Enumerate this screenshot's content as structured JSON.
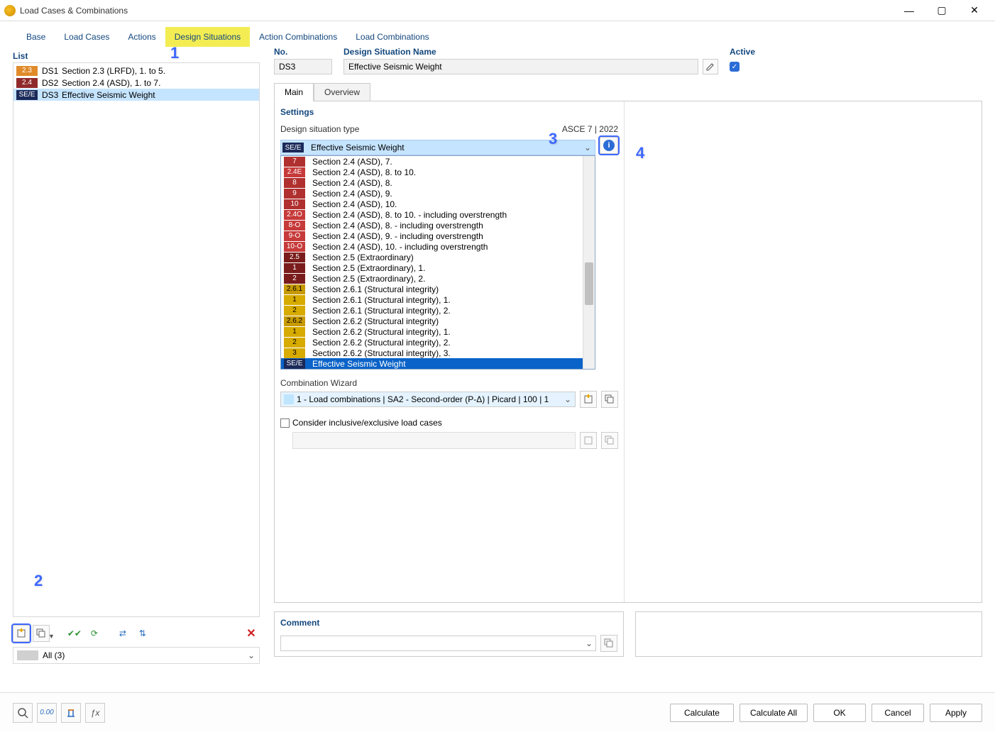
{
  "window": {
    "title": "Load Cases & Combinations"
  },
  "tabs": [
    {
      "label": "Base"
    },
    {
      "label": "Load Cases"
    },
    {
      "label": "Actions"
    },
    {
      "label": "Design Situations",
      "active": true
    },
    {
      "label": "Action Combinations"
    },
    {
      "label": "Load Combinations"
    }
  ],
  "left": {
    "title": "List",
    "items": [
      {
        "tag": "2.3",
        "tagClass": "c-orange",
        "id": "DS1",
        "name": "Section 2.3 (LRFD), 1. to 5."
      },
      {
        "tag": "2.4",
        "tagClass": "c-maroon",
        "id": "DS2",
        "name": "Section 2.4 (ASD), 1. to 7."
      },
      {
        "tag": "SE/E",
        "tagClass": "c-navy",
        "id": "DS3",
        "name": "Effective Seismic Weight",
        "selected": true
      }
    ],
    "filter": "All (3)"
  },
  "header": {
    "no_label": "No.",
    "no_value": "DS3",
    "name_label": "Design Situation Name",
    "name_value": "Effective Seismic Weight",
    "active_label": "Active"
  },
  "subtabs": {
    "main": "Main",
    "overview": "Overview"
  },
  "settings": {
    "title": "Settings",
    "type_label": "Design situation type",
    "code": "ASCE 7 | 2022",
    "combo_tag": "SE/E",
    "combo_text": "Effective Seismic Weight",
    "options": [
      {
        "tag": "7",
        "tc": "c-red1",
        "text": "Section 2.4 (ASD), 7."
      },
      {
        "tag": "2.4E",
        "tc": "c-red2",
        "text": "Section 2.4 (ASD), 8. to 10."
      },
      {
        "tag": "8",
        "tc": "c-red1",
        "text": "Section 2.4 (ASD), 8."
      },
      {
        "tag": "9",
        "tc": "c-red1",
        "text": "Section 2.4 (ASD), 9."
      },
      {
        "tag": "10",
        "tc": "c-red1",
        "text": "Section 2.4 (ASD), 10."
      },
      {
        "tag": "2.4O",
        "tc": "c-red2",
        "text": "Section 2.4 (ASD), 8. to 10. - including overstrength"
      },
      {
        "tag": "8-O",
        "tc": "c-red2",
        "text": "Section 2.4 (ASD), 8. - including overstrength"
      },
      {
        "tag": "9-O",
        "tc": "c-red2",
        "text": "Section 2.4 (ASD), 9. - including overstrength"
      },
      {
        "tag": "10-O",
        "tc": "c-red2",
        "text": "Section 2.4 (ASD), 10. - including overstrength"
      },
      {
        "tag": "2.5",
        "tc": "c-darkred",
        "text": "Section 2.5 (Extraordinary)"
      },
      {
        "tag": "1",
        "tc": "c-darkred",
        "text": "Section 2.5 (Extraordinary), 1."
      },
      {
        "tag": "2",
        "tc": "c-darkred",
        "text": "Section 2.5 (Extraordinary), 2."
      },
      {
        "tag": "2.6.1",
        "tc": "c-gold-d",
        "text": "Section 2.6.1 (Structural integrity)"
      },
      {
        "tag": "1",
        "tc": "c-gold",
        "text": "Section 2.6.1 (Structural integrity), 1."
      },
      {
        "tag": "2",
        "tc": "c-gold",
        "text": "Section 2.6.1 (Structural integrity), 2."
      },
      {
        "tag": "2.6.2",
        "tc": "c-gold-d",
        "text": "Section 2.6.2 (Structural integrity)"
      },
      {
        "tag": "1",
        "tc": "c-gold",
        "text": "Section 2.6.2 (Structural integrity), 1."
      },
      {
        "tag": "2",
        "tc": "c-gold",
        "text": "Section 2.6.2 (Structural integrity), 2."
      },
      {
        "tag": "3",
        "tc": "c-gold",
        "text": "Section 2.6.2 (Structural integrity), 3."
      },
      {
        "tag": "SE/E",
        "tc": "c-sele",
        "text": "Effective Seismic Weight",
        "selected": true
      }
    ],
    "wizard_label": "Combination Wizard",
    "wizard_value": "1 - Load combinations | SA2 - Second-order (P-Δ) | Picard | 100 | 1",
    "inclusive_label": "Consider inclusive/exclusive load cases"
  },
  "comment": {
    "label": "Comment"
  },
  "footer": {
    "calculate": "Calculate",
    "calculate_all": "Calculate All",
    "ok": "OK",
    "cancel": "Cancel",
    "apply": "Apply"
  },
  "callouts": {
    "c1": "1",
    "c2": "2",
    "c3": "3",
    "c4": "4"
  }
}
